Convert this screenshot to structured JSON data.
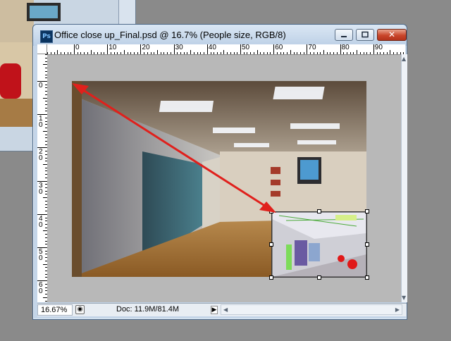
{
  "window": {
    "title": "Office close up_Final.psd @ 16.7% (People size, RGB/8)",
    "app_icon_label": "Ps",
    "close_glyph": "✕"
  },
  "ruler": {
    "h_labels": [
      "0",
      "10",
      "20",
      "30",
      "40",
      "50",
      "60",
      "70",
      "80",
      "90"
    ],
    "v_labels": [
      "0",
      "1\n0",
      "2\n0",
      "3\n0",
      "4\n0",
      "5\n0",
      "6\n0"
    ]
  },
  "statusbar": {
    "zoom": "16.67%",
    "doc_info": "Doc: 11.9M/81.4M",
    "arrow_glyph": "▶"
  },
  "colors": {
    "annotation_arrow": "#e0201c",
    "close_button": "#c9462b",
    "canvas_bg": "#b8b8b8"
  }
}
